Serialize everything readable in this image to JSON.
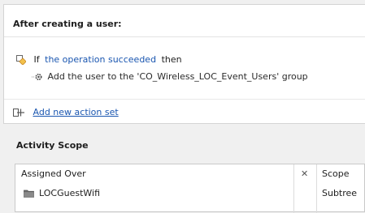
{
  "section": {
    "title": "After creating a user:"
  },
  "condition": {
    "if_label": "If",
    "condition_link": "the operation succeeded",
    "then_label": "then"
  },
  "action": {
    "text": "Add the user to the 'CO_Wireless_LOC_Event_Users' group"
  },
  "add_action": {
    "label": "Add new action set"
  },
  "scope": {
    "title": "Activity Scope",
    "columns": {
      "assigned_over": "Assigned Over",
      "remove": "✕",
      "scope": "Scope"
    },
    "rows": [
      {
        "name": "LOCGuestWifi",
        "scope": "Subtree"
      }
    ]
  },
  "colors": {
    "link": "#1a56b0",
    "accent_orange": "#e8a33d"
  }
}
